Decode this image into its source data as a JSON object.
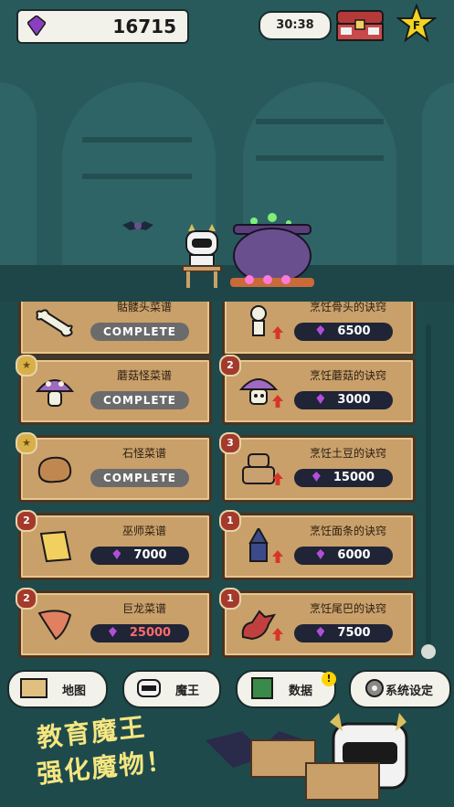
{
  "header": {
    "gems": "16715",
    "timer": "30:38"
  },
  "cards": [
    {
      "title": "骷髅头菜谱",
      "status": "COMPLETE",
      "badge": "",
      "art": "bone-icon"
    },
    {
      "title": "烹饪骨头的诀窍",
      "price": "6500",
      "badge": "",
      "art": "skeleton-icon"
    },
    {
      "title": "蘑菇怪菜谱",
      "status": "COMPLETE",
      "badge": "★",
      "art": "mushroom-icon"
    },
    {
      "title": "烹饪蘑菇的诀窍",
      "price": "3000",
      "badge": "2",
      "art": "mushroom-monster-icon"
    },
    {
      "title": "石怪菜谱",
      "status": "COMPLETE",
      "badge": "★",
      "art": "rock-icon"
    },
    {
      "title": "烹饪土豆的诀窍",
      "price": "15000",
      "badge": "3",
      "art": "golem-icon"
    },
    {
      "title": "巫师菜谱",
      "price": "7000",
      "badge": "2",
      "art": "scroll-icon"
    },
    {
      "title": "烹饪面条的诀窍",
      "price": "6000",
      "badge": "1",
      "art": "wizard-icon"
    },
    {
      "title": "巨龙菜谱",
      "price": "25000",
      "badge": "2",
      "art": "claw-icon",
      "price_color": "#ff6b6b"
    },
    {
      "title": "烹饪尾巴的诀窍",
      "price": "7500",
      "badge": "1",
      "art": "dragon-icon"
    }
  ],
  "nav": {
    "map": "地图",
    "demon": "魔王",
    "data": "数据",
    "data_alert": "!",
    "settings": "系统设定"
  },
  "promo": {
    "line1": "教育魔王",
    "line2": "强化魔物！"
  }
}
